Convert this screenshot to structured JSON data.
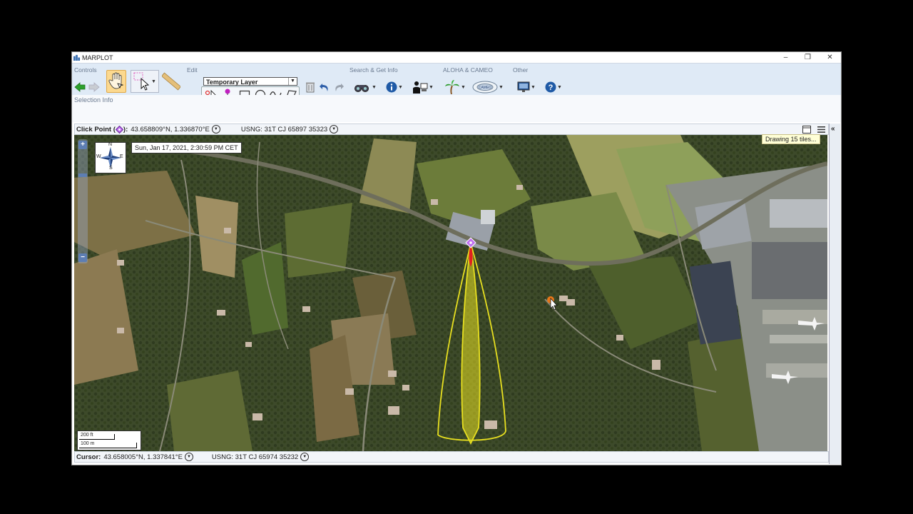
{
  "window": {
    "title": "MARPLOT",
    "minimize": "–",
    "restore": "❐",
    "close": "✕"
  },
  "ribbon": {
    "groups": {
      "controls": "Controls",
      "edit": "Edit",
      "search": "Search & Get Info",
      "aloha": "ALOHA & CAMEO",
      "other": "Other"
    },
    "layer_select": "Temporary Layer",
    "selection_info": "Selection Info"
  },
  "click_point": {
    "label": "Click Point (",
    "label_end": "):",
    "coords": "43.658809°N, 1.336870°E",
    "usng": "USNG: 31T CJ 65897 35323"
  },
  "cursor": {
    "label": "Cursor:",
    "coords": "43.658005°N, 1.337841°E",
    "usng": "USNG: 31T CJ 65974 35232"
  },
  "map": {
    "timestamp": "Sun, Jan 17, 2021, 2:30:59 PM CET",
    "compass": {
      "n": "N",
      "s": "S",
      "e": "E",
      "w": "W"
    },
    "zoom_in": "+",
    "zoom_out": "−",
    "scale_ft": "200 ft",
    "scale_m": "100 m",
    "plume_color": "#e8e020",
    "source_color": "#b040ff"
  },
  "status_tooltip": "Drawing 15 tiles..."
}
